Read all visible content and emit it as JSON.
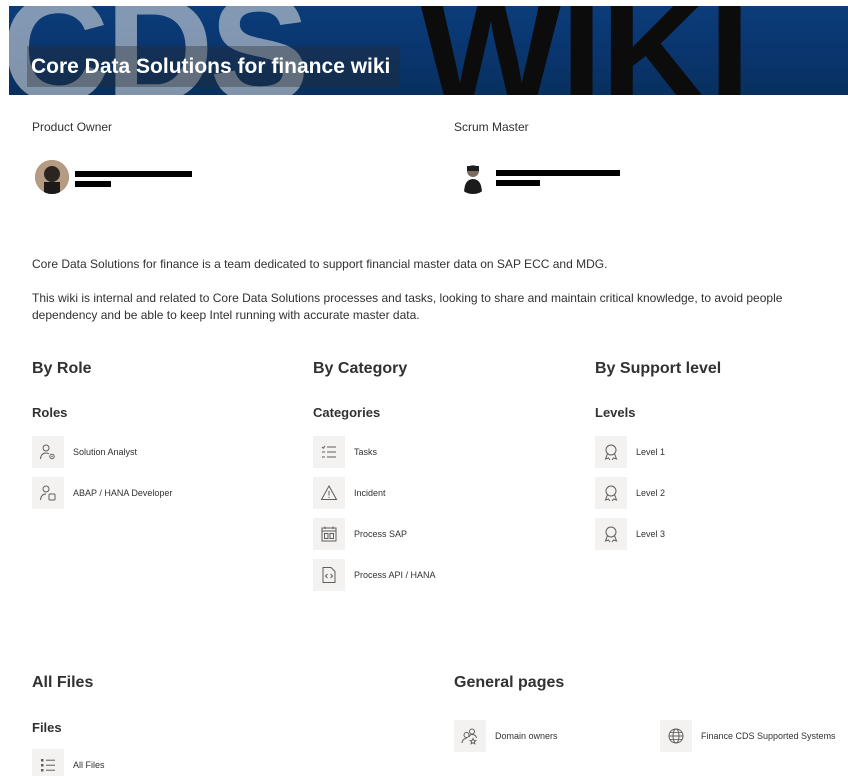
{
  "banner": {
    "title": "Core Data Solutions for finance wiki",
    "watermark_left": "CDS",
    "watermark_right": "WIKI"
  },
  "people": {
    "owner_label": "Product Owner",
    "scrum_label": "Scrum Master"
  },
  "intro": {
    "line1": "Core Data Solutions for finance is a team dedicated to support financial master data on SAP ECC and MDG.",
    "line2": "This wiki is internal and related to Core Data Solutions processes and tasks, looking to share and maintain critical knowledge, to avoid people dependency and be able to keep Intel running with accurate master data."
  },
  "by_role": {
    "heading": "By Role",
    "subheading": "Roles",
    "items": [
      {
        "label": "Solution Analyst",
        "icon": "person-gear-icon"
      },
      {
        "label": "ABAP / HANA Developer",
        "icon": "person-device-icon"
      }
    ]
  },
  "by_category": {
    "heading": "By Category",
    "subheading": "Categories",
    "items": [
      {
        "label": "Tasks",
        "icon": "task-list-icon"
      },
      {
        "label": "Incident",
        "icon": "warning-icon"
      },
      {
        "label": "Process SAP",
        "icon": "calendar-icon"
      },
      {
        "label": "Process API / HANA",
        "icon": "code-file-icon"
      }
    ]
  },
  "by_support": {
    "heading": "By Support level",
    "subheading": "Levels",
    "items": [
      {
        "label": "Level 1",
        "icon": "award-icon"
      },
      {
        "label": "Level 2",
        "icon": "award-icon"
      },
      {
        "label": "Level 3",
        "icon": "award-icon"
      }
    ]
  },
  "all_files": {
    "heading": "All Files",
    "subheading": "Files",
    "items": [
      {
        "label": "All Files",
        "icon": "bulleted-list-icon"
      }
    ]
  },
  "general_pages": {
    "heading": "General pages",
    "items": [
      {
        "label": "Domain owners",
        "icon": "people-star-icon"
      },
      {
        "label": "Finance CDS Supported Systems",
        "icon": "globe-icon"
      }
    ]
  },
  "colors": {
    "banner": "#0a3670",
    "text": "#323130",
    "icon_bg": "#f3f2f1"
  }
}
